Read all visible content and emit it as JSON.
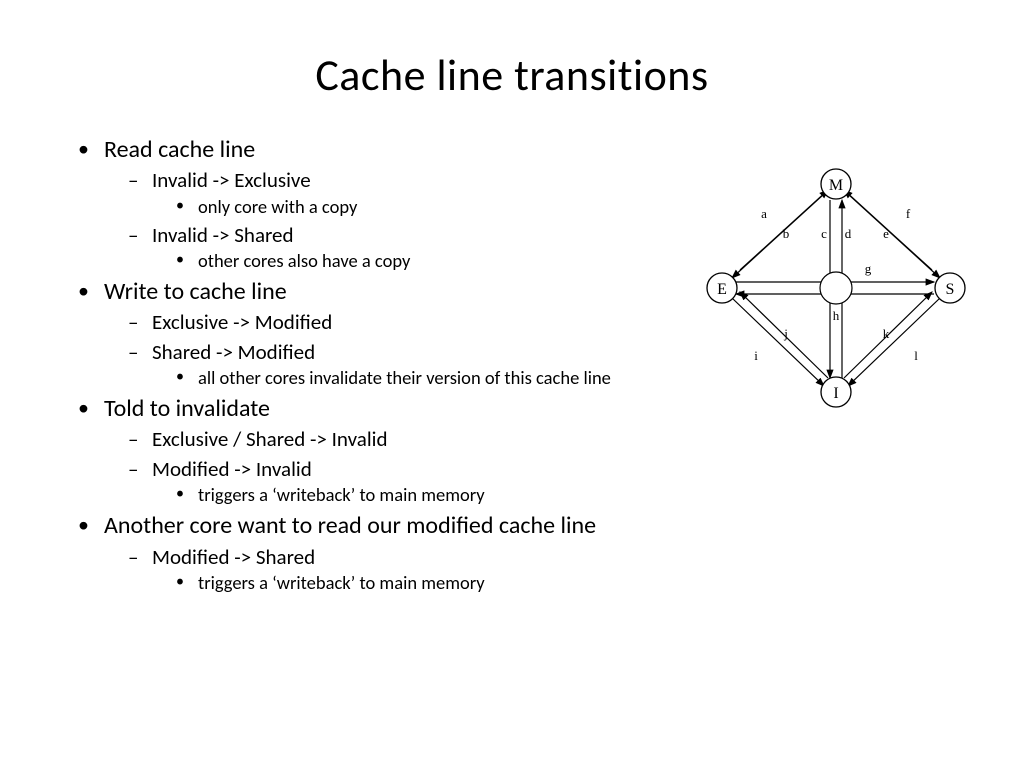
{
  "title": "Cache line transitions",
  "bullets": {
    "b0": "Read cache line",
    "b0s0": "Invalid -> Exclusive",
    "b0s0d": "only core with a copy",
    "b0s1": "Invalid -> Shared",
    "b0s1d": "other cores also have a copy",
    "b1": "Write to cache line",
    "b1s0": "Exclusive -> Modified",
    "b1s1": "Shared -> Modified",
    "b1s1d": "all other cores invalidate their version of this cache line",
    "b2": "Told to invalidate",
    "b2s0": "Exclusive / Shared -> Invalid",
    "b2s1": "Modified -> Invalid",
    "b2s1d": "triggers a ‘writeback’ to main memory",
    "b3": "Another core want to read our modified cache line",
    "b3s0": "Modified -> Shared",
    "b3s0d": "triggers a ‘writeback’ to main memory"
  },
  "graph": {
    "nodes": {
      "top": "M",
      "left": "E",
      "right": "S",
      "bottom": "I"
    },
    "edges": {
      "a": "a",
      "b": "b",
      "c": "c",
      "d": "d",
      "e": "e",
      "f": "f",
      "g": "g",
      "h": "h",
      "i": "i",
      "j": "j",
      "k": "k",
      "l": "l"
    }
  }
}
